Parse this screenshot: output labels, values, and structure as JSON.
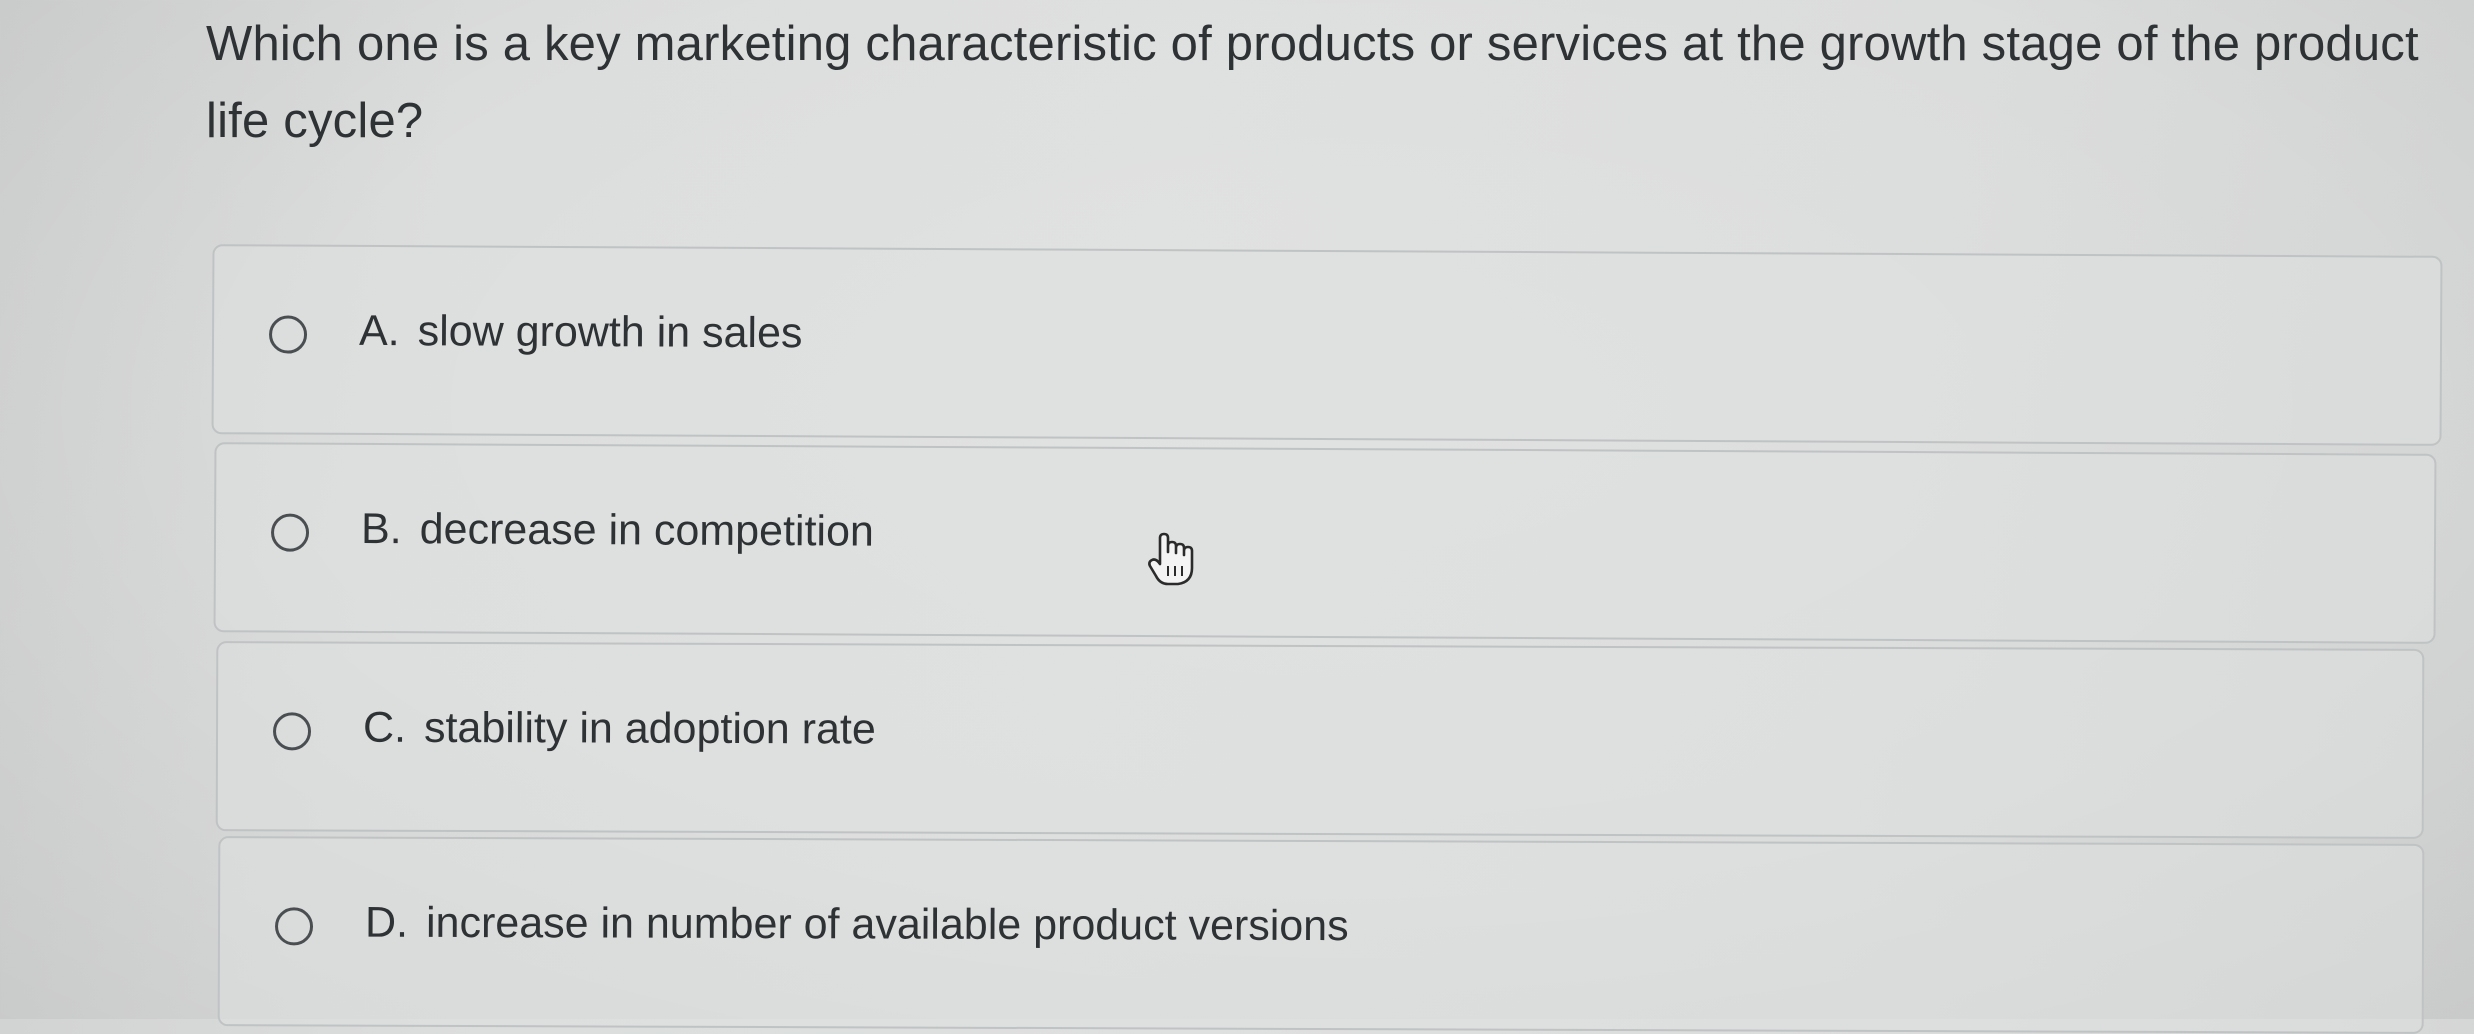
{
  "question": {
    "text": "Which one is a key marketing characteristic of products or services at the growth stage of the product life cycle?"
  },
  "options": [
    {
      "letter": "A.",
      "text": "slow growth in sales"
    },
    {
      "letter": "B.",
      "text": "decrease in competition"
    },
    {
      "letter": "C.",
      "text": "stability in adoption rate"
    },
    {
      "letter": "D.",
      "text": "increase in number of available product versions"
    }
  ],
  "cursor": {
    "icon": "hand-pointer-icon"
  },
  "colors": {
    "background": "#dcdddd",
    "text": "#2f3234",
    "border": "#c0c3c4",
    "radio": "#4a4e51"
  }
}
